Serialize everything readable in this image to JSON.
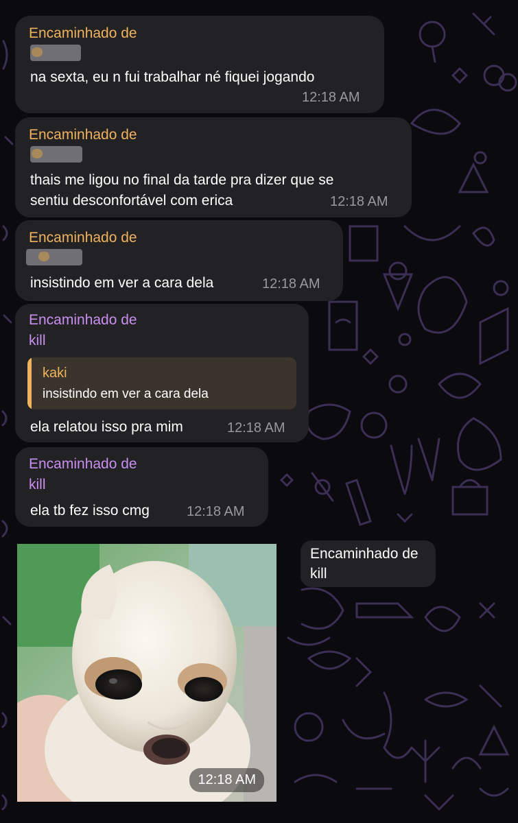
{
  "messages": [
    {
      "forward_label": "Encaminhado de",
      "text_lines": [
        "na sexta, eu n fui trabalhar né fiquei jogando"
      ],
      "time": "12:18 AM"
    },
    {
      "forward_label": "Encaminhado de",
      "text_lines": [
        "thais me ligou no final da tarde pra dizer que se",
        "sentiu desconfortável com erica"
      ],
      "time": "12:18 AM"
    },
    {
      "forward_label": "Encaminhado de",
      "text_lines": [
        "insistindo em ver a cara dela"
      ],
      "time": "12:18 AM"
    },
    {
      "forward_label": "Encaminhado de",
      "sender": "kill",
      "quote": {
        "name": "kaki",
        "text": "insistindo em ver a cara dela"
      },
      "text_lines": [
        "ela relatou isso pra mim"
      ],
      "time": "12:18 AM"
    },
    {
      "forward_label": "Encaminhado de",
      "sender": "kill",
      "text_lines": [
        "ela tb fez isso cmg"
      ],
      "time": "12:18 AM"
    }
  ],
  "photo_message": {
    "forward_label": "Encaminhado de",
    "sender": "kill",
    "time": "12:18 AM",
    "image_subject": "sad-chihuahua"
  },
  "colors": {
    "forward_name_orange": "#f0b35d",
    "forward_name_purple": "#c98ff0",
    "bubble": "#222124",
    "background": "#0b0a0e",
    "doodle": "#3b2f56"
  }
}
